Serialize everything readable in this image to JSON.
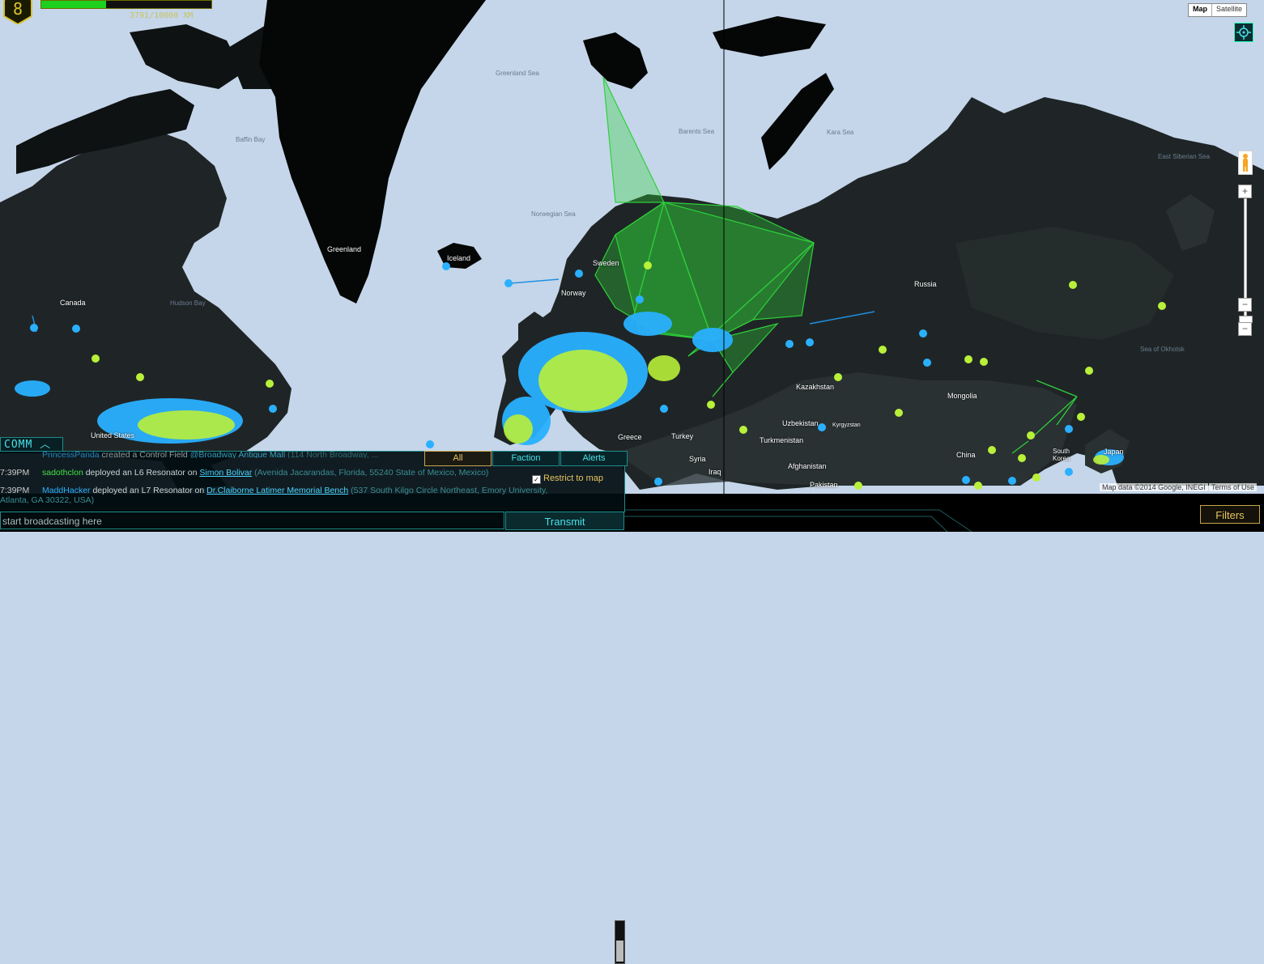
{
  "hud": {
    "level": "8",
    "xp_fraction": 0.38,
    "xm_text": "3791/10000 XM",
    "colors": {
      "enlightened": "#1dd01d",
      "resistance": "#29b0ff",
      "accent": "#49e1e7",
      "gold": "#e8c55e"
    }
  },
  "map_controls": {
    "map_label": "Map",
    "satellite_label": "Satellite",
    "zoom_in": "+",
    "zoom_out": "−",
    "zoom_in_small": "+",
    "zoom_out_small": "−",
    "attribution": "Map data ©2014 Google, INEGI",
    "terms": "Terms of Use",
    "locate_icon": "crosshair-icon",
    "pegman_icon": "street-view-icon"
  },
  "map_labels": {
    "seas": [
      "Greenland Sea",
      "Baffin Bay",
      "Norwegian Sea",
      "Barents Sea",
      "Kara Sea",
      "East Siberian Sea",
      "Hudson Bay",
      "Sea of Okhotsk"
    ],
    "countries": [
      "Greenland",
      "Iceland",
      "Canada",
      "Norway",
      "Sweden",
      "Russia",
      "Kazakhstan",
      "Mongolia",
      "Uzbekistan",
      "Kyrgyzstan",
      "Turkmenistan",
      "Afghanistan",
      "Pakistan",
      "China",
      "Turkey",
      "Syria",
      "Iraq",
      "Greece",
      "South Korea",
      "Japan",
      "United States"
    ]
  },
  "comm": {
    "tab_label": "COMM",
    "tabs": [
      {
        "label": "All"
      },
      {
        "label": "Faction"
      },
      {
        "label": "Alerts"
      }
    ],
    "restrict_label": "Restrict to map",
    "messages": [
      {
        "time": "",
        "player": "PrincessPanda",
        "action": "created a Control Field",
        "portal": "@Broadway Antique Mall",
        "address": "(114 North Broadway, ..."
      },
      {
        "time": "7:39PM",
        "player": "sadothclon",
        "action": "deployed an L6 Resonator on",
        "portal": "Simon Bolivar",
        "address": "(Avenida Jacarandas, Florida, 55240 State of Mexico, Mexico)"
      },
      {
        "time": "7:39PM",
        "player": "MaddHacker",
        "action": "deployed an L7 Resonator on",
        "portal": "Dr.Claiborne Latimer Memorial Bench",
        "address": "(537 South Kilgo Circle Northeast, Emory University, Atlanta, GA 30322, USA)"
      }
    ],
    "input_placeholder": "start broadcasting here",
    "transmit_label": "Transmit"
  },
  "filters_label": "Filters"
}
